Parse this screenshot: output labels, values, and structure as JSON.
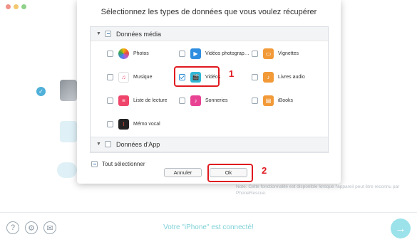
{
  "dialog": {
    "title": "Sélectionnez les types de données que vous voulez récupérer",
    "categories": [
      {
        "label": "Données média",
        "items": [
          {
            "label": "Photos",
            "icon": "photos-icon",
            "checked": false
          },
          {
            "label": "Vidéos photograp…",
            "icon": "photo-videos-icon",
            "checked": false
          },
          {
            "label": "Vignettes",
            "icon": "thumbnails-icon",
            "checked": false
          },
          {
            "label": "Musique",
            "icon": "music-icon",
            "checked": false
          },
          {
            "label": "Vidéos",
            "icon": "videos-icon",
            "checked": true
          },
          {
            "label": "Livres audio",
            "icon": "audiobooks-icon",
            "checked": false
          },
          {
            "label": "Liste de lecture",
            "icon": "playlist-icon",
            "checked": false
          },
          {
            "label": "Sonneries",
            "icon": "ringtones-icon",
            "checked": false
          },
          {
            "label": "iBooks",
            "icon": "ibooks-icon",
            "checked": false
          },
          {
            "label": "Mémo vocal",
            "icon": "voice-memo-icon",
            "checked": false
          }
        ]
      },
      {
        "label": "Données d'App",
        "items": []
      }
    ],
    "select_all_label": "Tout sélectionner",
    "cancel_label": "Annuler",
    "ok_label": "Ok",
    "annotations": [
      "1",
      "2"
    ]
  },
  "background": {
    "note": "Note: Cette fonctionnalité est disponible lorsque l'appareil peut être reconnu par PhoneRescue.",
    "status": "Votre \"iPhone\" est connecté!"
  },
  "colors": {
    "accent": "#2e8fd6",
    "highlight": "#e0191f",
    "status_text": "#7fd1d8",
    "next_button": "#9be2ea"
  }
}
